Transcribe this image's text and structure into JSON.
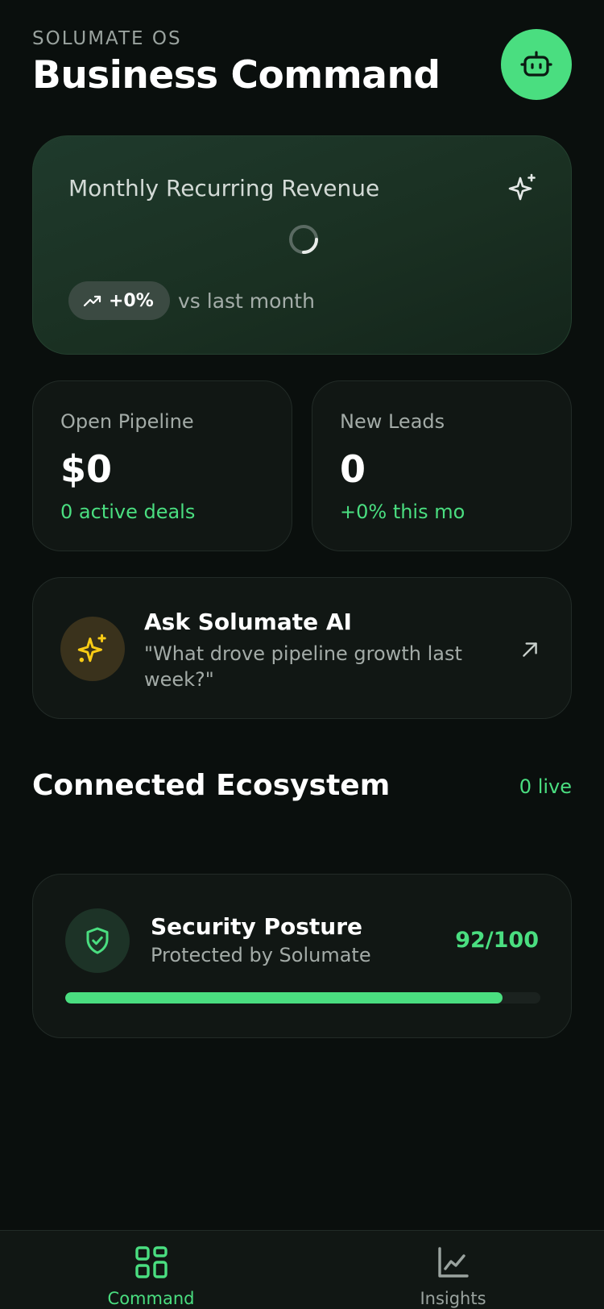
{
  "header": {
    "brand_sub": "SOLUMATE OS",
    "title": "Business Command",
    "assistant_icon": "robot-icon"
  },
  "mrr": {
    "label": "Monthly Recurring Revenue",
    "icon": "sparkles-icon",
    "loading": true,
    "trend_value": "+0%",
    "trend_caption": "vs last month"
  },
  "stats": [
    {
      "label": "Open Pipeline",
      "value": "$0",
      "sub": "0 active deals"
    },
    {
      "label": "New Leads",
      "value": "0",
      "sub": "+0% this mo"
    }
  ],
  "ai": {
    "title": "Ask Solumate AI",
    "prompt": "\"What drove pipeline growth last week?\"",
    "icon": "sparkles-icon",
    "action_icon": "arrow-up-right-icon"
  },
  "ecosystem": {
    "title": "Connected Ecosystem",
    "live": "0 live"
  },
  "security": {
    "title": "Security Posture",
    "subtitle": "Protected by Solumate",
    "score": "92/100",
    "score_fraction": 0.92,
    "icon": "shield-check-icon"
  },
  "nav": {
    "items": [
      {
        "label": "Command",
        "icon": "grid-icon",
        "active": true
      },
      {
        "label": "Insights",
        "icon": "chart-line-icon",
        "active": false
      }
    ]
  },
  "colors": {
    "accent": "#4ade80",
    "background": "#0a0f0d",
    "card": "#111714",
    "ai_icon": "#facc15"
  }
}
